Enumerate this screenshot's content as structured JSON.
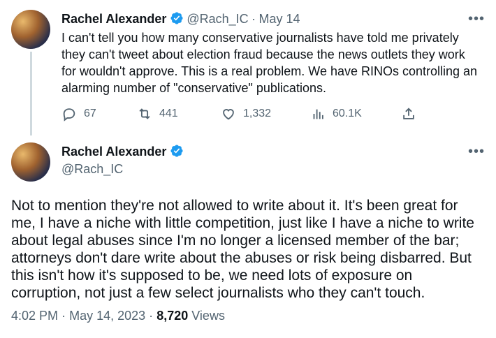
{
  "tweet1": {
    "name": "Rachel Alexander",
    "handle": "@Rach_IC",
    "separator": "·",
    "date": "May 14",
    "text": "I can't tell you how many conservative journalists have told me privately they can't tweet about election fraud because the news outlets they work for wouldn't approve. This is a real problem. We have RINOs controlling an alarming number of \"conservative\" publications.",
    "replies": "67",
    "retweets": "441",
    "likes": "1,332",
    "views": "60.1K"
  },
  "tweet2": {
    "name": "Rachel Alexander",
    "handle": "@Rach_IC",
    "text": "Not to mention they're not allowed to write about it. It's been great for me, I have a niche with little competition, just like I have a niche to write about legal abuses since I'm no longer a licensed member of the bar; attorneys don't dare write about the abuses or risk being disbarred. But this isn't how it's supposed to be, we need lots of exposure on corruption, not just a few select journalists who they can't touch.",
    "time": "4:02 PM",
    "dot": "·",
    "full_date": "May 14, 2023",
    "views_count": "8,720",
    "views_label": "Views"
  },
  "more_label": "•••",
  "colors": {
    "verified": "#1d9bf0",
    "muted": "#536471",
    "text": "#0f1419",
    "line": "#cfd9de"
  }
}
